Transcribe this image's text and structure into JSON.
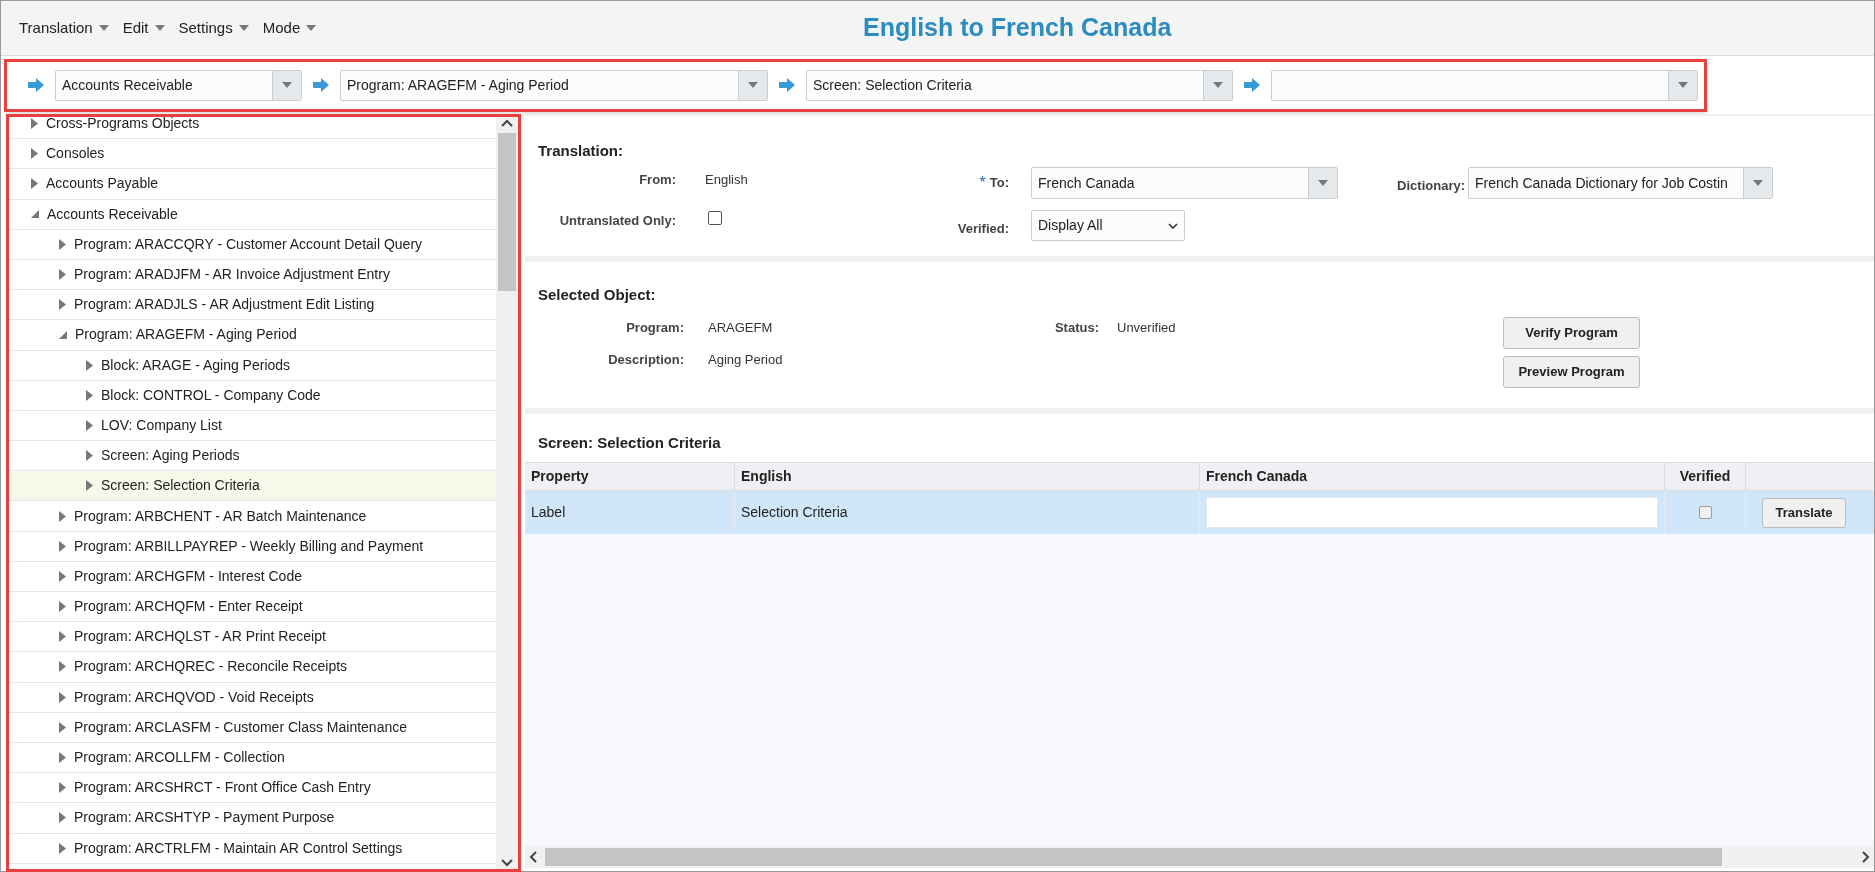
{
  "menu": [
    {
      "label": "Translation"
    },
    {
      "label": "Edit"
    },
    {
      "label": "Settings"
    },
    {
      "label": "Mode"
    }
  ],
  "title": "English to French Canada",
  "breadcrumbs": [
    {
      "value": "Accounts Receivable"
    },
    {
      "value": "Program: ARAGEFM - Aging Period"
    },
    {
      "value": "Screen: Selection Criteria"
    }
  ],
  "tree": [
    {
      "label": "Cross-Programs Objects",
      "expanded": false,
      "selected": false
    },
    {
      "label": "Consoles",
      "expanded": false,
      "selected": false
    },
    {
      "label": "Accounts Payable",
      "expanded": false,
      "selected": false
    },
    {
      "label": "Accounts Receivable",
      "expanded": true,
      "selected": false,
      "children": [
        {
          "label": "Program: ARACCQRY - Customer Account Detail Query",
          "expanded": false,
          "selected": false
        },
        {
          "label": "Program: ARADJFM - AR Invoice Adjustment Entry",
          "expanded": false,
          "selected": false
        },
        {
          "label": "Program: ARADJLS - AR Adjustment Edit Listing",
          "expanded": false,
          "selected": false
        },
        {
          "label": "Program: ARAGEFM - Aging Period",
          "expanded": true,
          "selected": false,
          "children": [
            {
              "label": "Block: ARAGE - Aging Periods",
              "expanded": false,
              "selected": false
            },
            {
              "label": "Block: CONTROL - Company Code",
              "expanded": false,
              "selected": false
            },
            {
              "label": "LOV: Company List",
              "expanded": false,
              "selected": false
            },
            {
              "label": "Screen: Aging Periods",
              "expanded": false,
              "selected": false
            },
            {
              "label": "Screen: Selection Criteria",
              "expanded": false,
              "selected": true
            }
          ]
        },
        {
          "label": "Program: ARBCHENT - AR Batch Maintenance",
          "expanded": false,
          "selected": false
        },
        {
          "label": "Program: ARBILLPAYREP - Weekly Billing and Payment",
          "expanded": false,
          "selected": false
        },
        {
          "label": "Program: ARCHGFM - Interest Code",
          "expanded": false,
          "selected": false
        },
        {
          "label": "Program: ARCHQFM - Enter Receipt",
          "expanded": false,
          "selected": false
        },
        {
          "label": "Program: ARCHQLST - AR Print Receipt",
          "expanded": false,
          "selected": false
        },
        {
          "label": "Program: ARCHQREC - Reconcile Receipts",
          "expanded": false,
          "selected": false
        },
        {
          "label": "Program: ARCHQVOD - Void Receipts",
          "expanded": false,
          "selected": false
        },
        {
          "label": "Program: ARCLASFM - Customer Class Maintenance",
          "expanded": false,
          "selected": false
        },
        {
          "label": "Program: ARCOLLFM - Collection",
          "expanded": false,
          "selected": false
        },
        {
          "label": "Program: ARCSHRCT - Front Office Cash Entry",
          "expanded": false,
          "selected": false
        },
        {
          "label": "Program: ARCSHTYP - Payment Purpose",
          "expanded": false,
          "selected": false
        },
        {
          "label": "Program: ARCTRLFM - Maintain AR Control Settings",
          "expanded": false,
          "selected": false
        }
      ]
    }
  ],
  "translation": {
    "heading": "Translation:",
    "from_label": "From:",
    "from_value": "English",
    "untranslated_label": "Untranslated Only:",
    "untranslated_checked": false,
    "required_mark": "*",
    "to_label": "To:",
    "to_value": "French Canada",
    "verified_label": "Verified:",
    "verified_value": "Display All",
    "dictionary_label": "Dictionary:",
    "dictionary_value": "French Canada Dictionary for Job Costin"
  },
  "selected_object": {
    "heading": "Selected Object:",
    "program_label": "Program:",
    "program_value": "ARAGEFM",
    "description_label": "Description:",
    "description_value": "Aging Period",
    "status_label": "Status:",
    "status_value": "Unverified",
    "buttons": [
      "Verify Program",
      "Preview Program"
    ]
  },
  "screen_table": {
    "heading": "Screen: Selection Criteria",
    "columns": [
      "Property",
      "English",
      "French Canada",
      "Verified"
    ],
    "rows": [
      {
        "property": "Label",
        "english": "Selection Criteria",
        "verified": false,
        "selected": true,
        "action": "Translate"
      }
    ]
  }
}
